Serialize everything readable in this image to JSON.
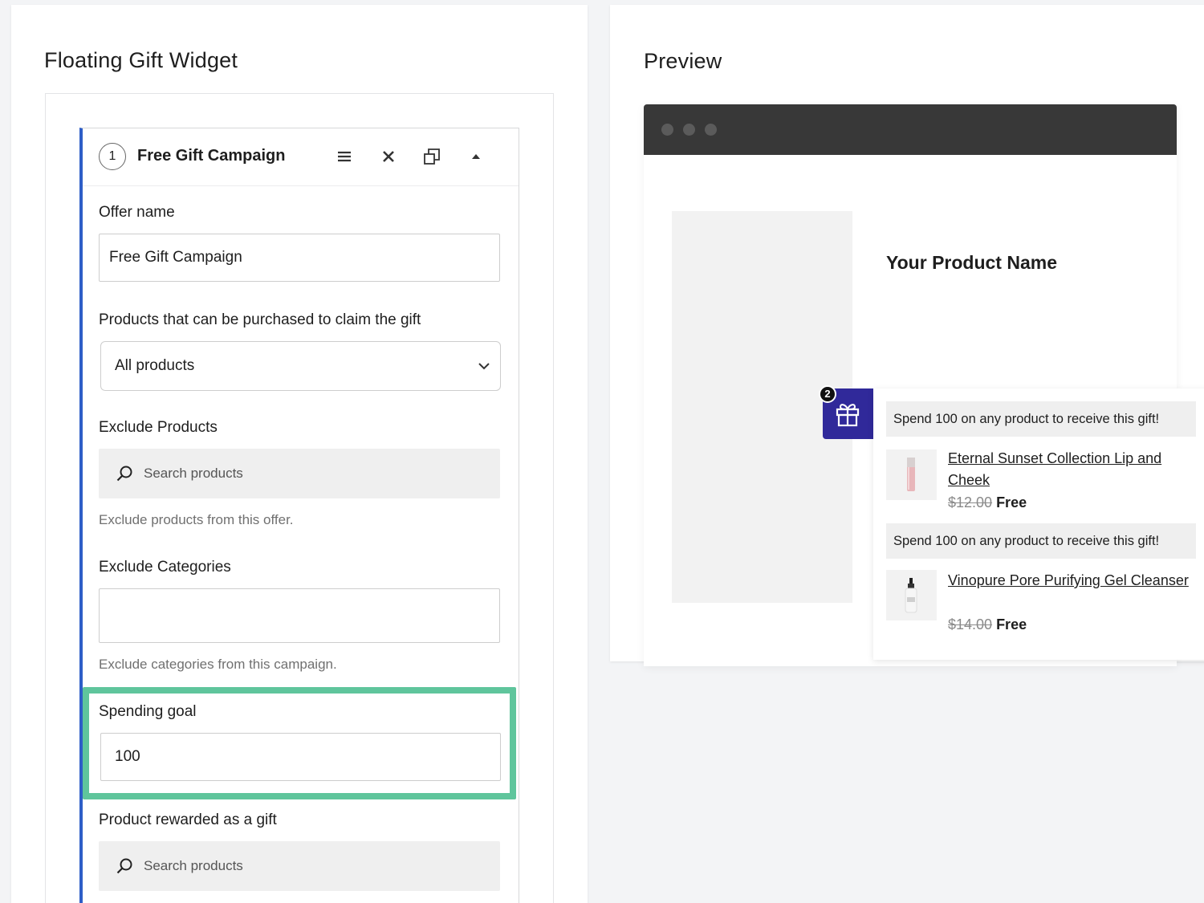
{
  "settings": {
    "title": "Floating Gift Widget",
    "campaign": {
      "step": "1",
      "title": "Free Gift Campaign",
      "offer_name_label": "Offer name",
      "offer_name_value": "Free Gift Campaign",
      "products_label": "Products that can be purchased to claim the gift",
      "products_value": "All products",
      "exclude_products_label": "Exclude Products",
      "exclude_products_placeholder": "Search products",
      "exclude_products_help": "Exclude products from this offer.",
      "exclude_categories_label": "Exclude Categories",
      "exclude_categories_value": "",
      "exclude_categories_help": "Exclude categories from this campaign.",
      "spending_goal_label": "Spending goal",
      "spending_goal_value": "100",
      "gift_product_label": "Product rewarded as a gift",
      "gift_product_placeholder": "Search products"
    }
  },
  "preview": {
    "title": "Preview",
    "product_name": "Your Product Name",
    "gift_count": "2",
    "offers": [
      {
        "banner": "Spend 100 on any product to receive this gift!",
        "product": "Eternal Sunset Collection Lip and Cheek",
        "old_price": "$12.00",
        "new_price": "Free"
      },
      {
        "banner": "Spend 100 on any product to receive this gift!",
        "product": "Vinopure Pore Purifying Gel Cleanser",
        "old_price": "$14.00",
        "new_price": "Free"
      }
    ]
  },
  "colors": {
    "accent_blue": "#2e5ec7",
    "highlight_green": "#5fc59c",
    "gift_purple": "#30299a",
    "browser_bar": "#383838"
  },
  "icons": [
    "menu-icon",
    "close-icon",
    "duplicate-icon",
    "collapse-arrow-icon",
    "chevron-down-icon",
    "search-icon",
    "gift-icon"
  ]
}
